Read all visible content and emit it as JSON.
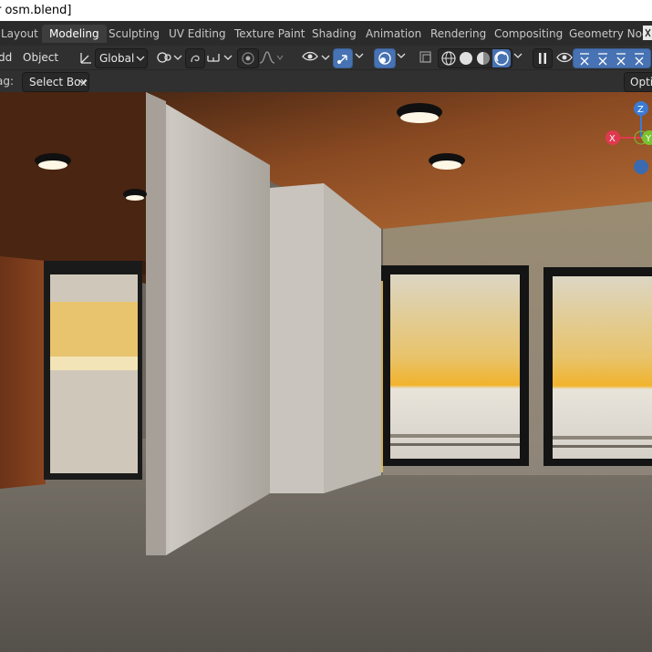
{
  "window": {
    "title": "r osm.blend]"
  },
  "workspaces": {
    "tabs": [
      {
        "label": "Layout"
      },
      {
        "label": "Modeling"
      },
      {
        "label": "Sculpting"
      },
      {
        "label": "UV Editing"
      },
      {
        "label": "Texture Paint"
      },
      {
        "label": "Shading"
      },
      {
        "label": "Animation"
      },
      {
        "label": "Rendering"
      },
      {
        "label": "Compositing"
      },
      {
        "label": "Geometry Nod"
      }
    ],
    "active": "Modeling"
  },
  "toolbar": {
    "add_label": "dd",
    "object_label": "Object",
    "orientation_value": "Global",
    "icons": [
      "transform-orientation-icon",
      "pivot-icon",
      "snap-icon",
      "snap-target-icon",
      "proportional-edit-icon",
      "falloff-icon",
      "visibility-icon",
      "gizmo-icon",
      "overlay-icon",
      "xray-icon",
      "wireframe-shading-icon",
      "solid-shading-icon",
      "material-shading-icon",
      "rendered-shading-icon",
      "pause-icon",
      "eye-icon"
    ]
  },
  "header2": {
    "drag_label": "ag:",
    "select_mode": "Select Box",
    "options_label": "Optic"
  },
  "gizmo": {
    "z_label": "Z",
    "x_label": "X",
    "y_label": "Y",
    "colors": {
      "x": "#e0394f",
      "y": "#7ac232",
      "z": "#3a7bd5"
    }
  },
  "colors": {
    "accent": "#4772b3",
    "header_bg": "#303030",
    "tabbar_bg": "#2b2b2b"
  }
}
